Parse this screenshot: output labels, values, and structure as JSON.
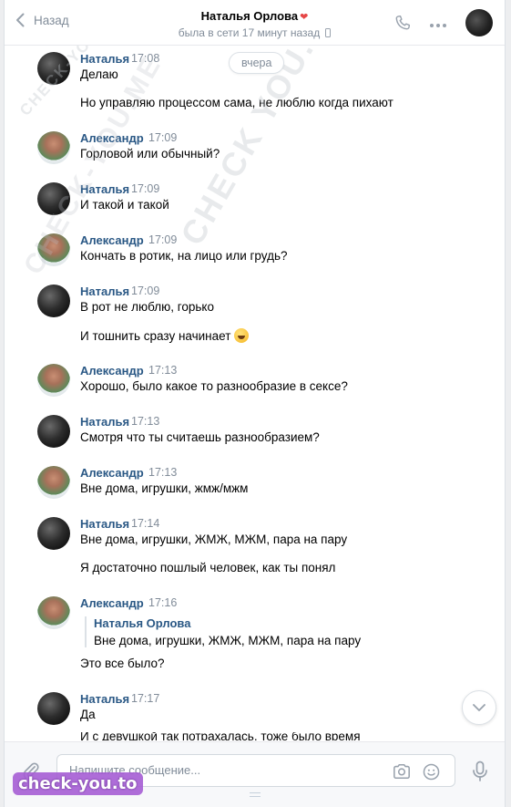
{
  "header": {
    "back_label": "Назад",
    "title": "Наталья Орлова",
    "heart": "❤",
    "status": "была в сети 17 минут назад"
  },
  "date_pill": "вчера",
  "messages": [
    {
      "author": "Наталья",
      "time": "17:08",
      "lines": [
        "Делаю",
        "Но управляю процессом сама, не люблю когда пихают"
      ]
    },
    {
      "author": "Александр",
      "time": "17:09",
      "lines": [
        "Горловой или обычный?"
      ]
    },
    {
      "author": "Наталья",
      "time": "17:09",
      "lines": [
        "И такой и такой"
      ]
    },
    {
      "author": "Александр",
      "time": "17:09",
      "lines": [
        "Кончать в ротик, на лицо или грудь?"
      ]
    },
    {
      "author": "Наталья",
      "time": "17:09",
      "lines": [
        "В рот не люблю, горько",
        "И тошнить сразу начинает"
      ]
    },
    {
      "author": "Александр",
      "time": "17:13",
      "lines": [
        "Хорошо, было какое то разнообразие в сексе?"
      ]
    },
    {
      "author": "Наталья",
      "time": "17:13",
      "lines": [
        "Смотря что ты считаешь разнообразием?"
      ]
    },
    {
      "author": "Александр",
      "time": "17:13",
      "lines": [
        "Вне дома, игрушки, жмж/мжм"
      ]
    },
    {
      "author": "Наталья",
      "time": "17:14",
      "lines": [
        "Вне дома, игрушки, ЖМЖ, МЖМ, пара на пару",
        "Я достаточно пошлый человек, как ты понял"
      ]
    },
    {
      "author": "Александр",
      "time": "17:16",
      "quote_author": "Наталья Орлова",
      "quote_text": "Вне дома, игрушки, ЖМЖ, МЖМ, пара на пару",
      "lines": [
        "Это все было?"
      ]
    },
    {
      "author": "Наталья",
      "time": "17:17",
      "lines": [
        "Да",
        "И с девушкой так потрахалась, тоже было время"
      ]
    }
  ],
  "composer": {
    "placeholder": "Напишите сообщение..."
  },
  "watermarks": {
    "diagonal_small": "CHECK-YOU.ME",
    "diagonal_mid": "CHECK YOU.ME",
    "diagonal_big": "CHECK-YOU.ME",
    "logo": "check-you.to"
  },
  "icons": [
    "back-chevron-icon",
    "phone-icon",
    "more-icon",
    "paperclip-icon",
    "camera-icon",
    "smile-icon",
    "microphone-icon",
    "chevron-down-icon"
  ],
  "colors": {
    "link_blue": "#2a5885",
    "muted_gray": "#818c99",
    "border": "#dce1e6",
    "background": "#edeef0"
  }
}
